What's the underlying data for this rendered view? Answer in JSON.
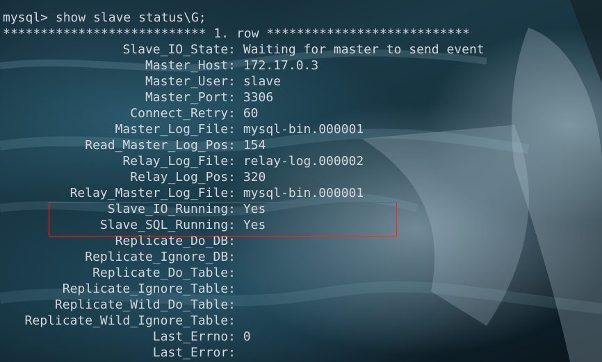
{
  "terminal": {
    "prompt": "mysql>",
    "command": "show slave status\\G;",
    "row_header": "*************************** 1. row ***************************",
    "fields": [
      {
        "name": "Slave_IO_State",
        "value": "Waiting for master to send event"
      },
      {
        "name": "Master_Host",
        "value": "172.17.0.3"
      },
      {
        "name": "Master_User",
        "value": "slave"
      },
      {
        "name": "Master_Port",
        "value": "3306"
      },
      {
        "name": "Connect_Retry",
        "value": "60"
      },
      {
        "name": "Master_Log_File",
        "value": "mysql-bin.000001"
      },
      {
        "name": "Read_Master_Log_Pos",
        "value": "154"
      },
      {
        "name": "Relay_Log_File",
        "value": "relay-log.000002"
      },
      {
        "name": "Relay_Log_Pos",
        "value": "320"
      },
      {
        "name": "Relay_Master_Log_File",
        "value": "mysql-bin.000001"
      },
      {
        "name": "Slave_IO_Running",
        "value": "Yes"
      },
      {
        "name": "Slave_SQL_Running",
        "value": "Yes"
      },
      {
        "name": "Replicate_Do_DB",
        "value": ""
      },
      {
        "name": "Replicate_Ignore_DB",
        "value": ""
      },
      {
        "name": "Replicate_Do_Table",
        "value": ""
      },
      {
        "name": "Replicate_Ignore_Table",
        "value": ""
      },
      {
        "name": "Replicate_Wild_Do_Table",
        "value": ""
      },
      {
        "name": "Replicate_Wild_Ignore_Table",
        "value": ""
      },
      {
        "name": "Last_Errno",
        "value": "0"
      },
      {
        "name": "Last_Error",
        "value": ""
      }
    ]
  },
  "colors": {
    "text": "#d2d8de",
    "highlight_border": "#c0403c"
  }
}
